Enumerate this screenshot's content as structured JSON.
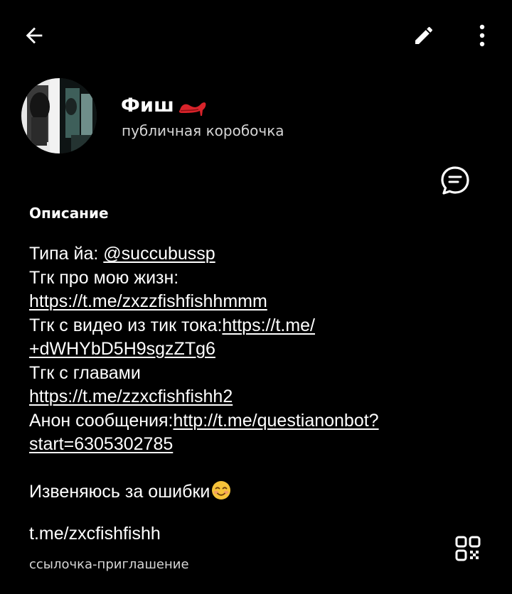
{
  "header": {
    "back_icon": "arrow-left-icon",
    "edit_icon": "pencil-icon",
    "more_icon": "vertical-dots-icon"
  },
  "channel": {
    "name": "Фиш",
    "name_emoji": "high-heel-icon",
    "subtitle": "публичная коробочка"
  },
  "comments_icon": "chat-bubble-icon",
  "description": {
    "heading": "Описание",
    "line1_text": "Типа йа: ",
    "line1_link": "@succubussp",
    "line2_text": "Тгк про мою жизн:",
    "line3_link": "https://t.me/zxzzfishfishhmmm",
    "line4_text": "Тгк с видео из тик тока:",
    "line4_link": "https://t.me/",
    "line5_link": "+dWHYbD5H9sgzZTg6",
    "line6_text": "Тгк с главами",
    "line7_link": "https://t.me/zzxcfishfishh2",
    "line8_text": "Анон сообщения:",
    "line8_link": "http://t.me/questianonbot?",
    "line9_link": "start=6305302785",
    "apology_text": "Извеняюсь за ошибки",
    "apology_emoji": "smiling-face-icon"
  },
  "invite": {
    "link": "t.me/zxcfishfishh",
    "caption": "ссылочка-приглашение",
    "qr_icon": "qr-code-icon"
  },
  "colors": {
    "background": "#000000",
    "text": "#ffffff",
    "secondary_text": "#d6d6d6"
  }
}
